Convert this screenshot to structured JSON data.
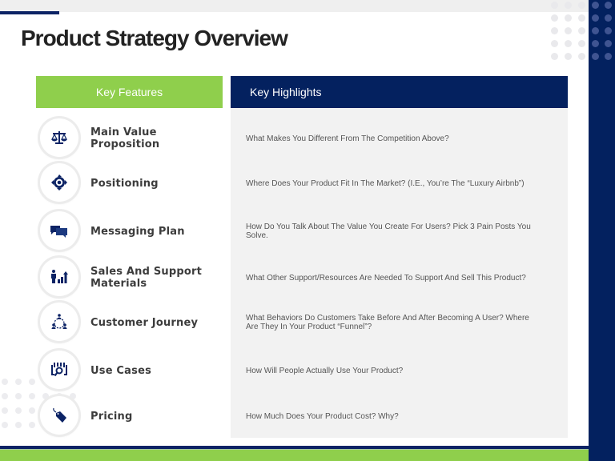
{
  "slide": {
    "title": "Product Strategy Overview",
    "colors": {
      "navy": "#04215f",
      "green": "#8fcf4c",
      "panel_gray": "#f2f2f2",
      "text_dark": "#222222"
    }
  },
  "table": {
    "left_header": "Key Features",
    "right_header": "Key Highlights",
    "rows": [
      {
        "icon": "scales-icon",
        "feature": "Main Value Proposition",
        "highlight": "What Makes You Different From The Competition Above?"
      },
      {
        "icon": "target-icon",
        "feature": "Positioning",
        "highlight": "Where Does Your Product Fit In The Market? (I.E., You’re The “Luxury Airbnb”)"
      },
      {
        "icon": "chat-bubbles-icon",
        "feature": "Messaging Plan",
        "highlight": "How Do You Talk About The Value You Create For Users? Pick 3 Pain Posts You Solve."
      },
      {
        "icon": "person-growth-chart-icon",
        "feature": "Sales And Support Materials",
        "highlight": "What Other Support/Resources Are Needed To Support And Sell This Product?"
      },
      {
        "icon": "network-people-icon",
        "feature": "Customer Journey",
        "highlight": "What Behaviors Do Customers Take Before And After Becoming A User? Where Are They In Your Product “Funnel”?"
      },
      {
        "icon": "search-analysis-icon",
        "feature": "Use Cases",
        "highlight": "How Will People Actually Use Your Product?"
      },
      {
        "icon": "price-tag-icon",
        "feature": "Pricing",
        "highlight": "How Much Does Your Product Cost? Why?"
      }
    ]
  }
}
